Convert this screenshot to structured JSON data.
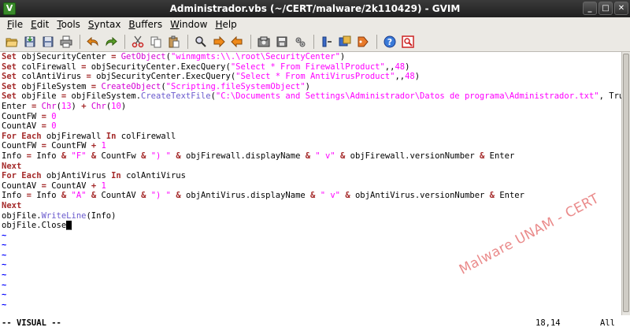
{
  "window": {
    "title": "Administrador.vbs (~/CERT/malware/2k110429) - GVIM",
    "app_icon_letter": "V",
    "buttons": [
      "minimize",
      "maximize",
      "close"
    ]
  },
  "menu": [
    "File",
    "Edit",
    "Tools",
    "Syntax",
    "Buffers",
    "Window",
    "Help"
  ],
  "toolbar_icons": [
    "open-icon",
    "save-icon",
    "save-all-icon",
    "print-icon",
    "undo-icon",
    "redo-icon",
    "cut-icon",
    "copy-icon",
    "paste-icon",
    "find-replace-icon",
    "find-next-icon",
    "find-prev-icon",
    "load-session-icon",
    "save-session-icon",
    "run-script-icon",
    "make-icon",
    "shell-icon",
    "find-tag-icon",
    "help-icon",
    "find-help-icon"
  ],
  "code_lines": [
    "Set objSecurityCenter = GetObject(\"winmgmts:\\\\.\\root\\SecurityCenter\")",
    "Set colFirewall = objSecurityCenter.ExecQuery(\"Select * From FirewallProduct\",,48)",
    "Set colAntiVirus = objSecurityCenter.ExecQuery(\"Select * From AntiVirusProduct\",,48)",
    "Set objFileSystem = CreateObject(\"Scripting.fileSystemObject\")",
    "Set objFile = objFileSystem.CreateTextFile(\"C:\\Documents and Settings\\Administrador\\Datos de programa\\Administrador.txt\", True)",
    "Enter = Chr(13) + Chr(10)",
    "CountFW = 0",
    "CountAV = 0",
    "For Each objFirewall In colFirewall",
    "CountFW = CountFW + 1",
    "Info = Info & \"F\" & CountFw & \") \" & objFirewall.displayName & \" v\" & objFirewall.versionNumber & Enter",
    "Next",
    "For Each objAntiVirus In colAntiVirus",
    "CountAV = CountAV + 1",
    "Info = Info & \"A\" & CountAV & \") \" & objAntiVirus.displayName & \" v\" & objAntiVirus.versionNumber & Enter",
    "Next",
    "objFile.WriteLine(Info)",
    "objFile.Close_"
  ],
  "empty_line_marker": "~",
  "empty_line_count": 8,
  "status": {
    "mode": "-- VISUAL --",
    "position": "18,14",
    "scroll": "All"
  },
  "watermark": "Malware UNAM - CERT",
  "colors": {
    "keyword": "#a52a2a",
    "string": "#ff00ff",
    "method": "#6a5acd",
    "tilde": "#0000ff",
    "watermark": "#dc3c3c"
  }
}
